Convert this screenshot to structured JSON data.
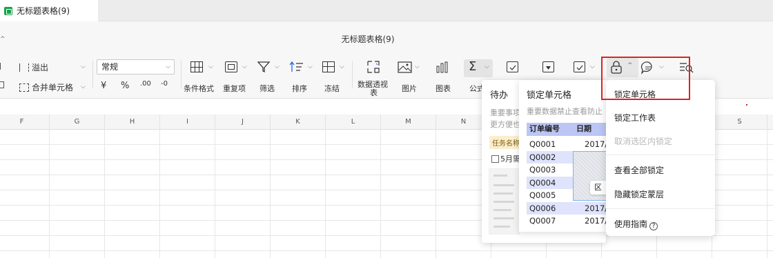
{
  "tab": {
    "title": "无标题表格(9)"
  },
  "document": {
    "title": "无标题表格(9)",
    "back_glyph": "^"
  },
  "ribbon": {
    "overflow_label": "溢出",
    "merge_label": "合并单元格",
    "format_select_value": "常规",
    "currency_symbol": "¥",
    "percent_symbol": "%",
    "increase_decimal": ".00",
    "decrease_decimal": "-0",
    "cond_format_label": "条件格式",
    "duplicates_label": "重复项",
    "filter_label": "筛选",
    "sort_label": "排序",
    "freeze_label": "冻结",
    "pivot_label_1": "数据透视",
    "pivot_label_2": "表",
    "image_label": "图片",
    "chart_label": "图表",
    "formula_label": "公式"
  },
  "columns": [
    "F",
    "G",
    "H",
    "I",
    "J",
    "K",
    "L",
    "M",
    "N",
    "S"
  ],
  "todo_panel": {
    "title": "待办",
    "desc_line1": "重要事项",
    "desc_line2": "更方便也",
    "tag": "任务名称",
    "checkbox_label": "5月需"
  },
  "lock_panel": {
    "title": "锁定单元格",
    "desc": "重要数据禁止查看防止",
    "table_header": {
      "id": "订单编号",
      "date": "日期"
    },
    "rows": [
      {
        "id": "Q0001",
        "date": "2017/"
      },
      {
        "id": "Q0002",
        "date": ""
      },
      {
        "id": "Q0003",
        "date": ""
      },
      {
        "id": "Q0004",
        "date": ""
      },
      {
        "id": "Q0005",
        "date": ""
      },
      {
        "id": "Q0006",
        "date": "2017/"
      },
      {
        "id": "Q0007",
        "date": "2017/"
      }
    ],
    "chip_text": "区"
  },
  "lock_menu": {
    "items": [
      {
        "label": "锁定单元格",
        "enabled": true
      },
      {
        "label": "锁定工作表",
        "enabled": true
      },
      {
        "label": "取消选区内锁定",
        "enabled": false
      },
      {
        "label": "查看全部锁定",
        "enabled": true
      },
      {
        "label": "隐藏锁定蒙层",
        "enabled": true
      },
      {
        "label": "使用指南",
        "enabled": true
      }
    ],
    "help_glyph": "?"
  },
  "colors": {
    "highlight": "#e02020",
    "lock_table_header": "#bcc6f5",
    "lock_table_alt": "#dfe3fb",
    "tab_icon": "#17a34a"
  }
}
